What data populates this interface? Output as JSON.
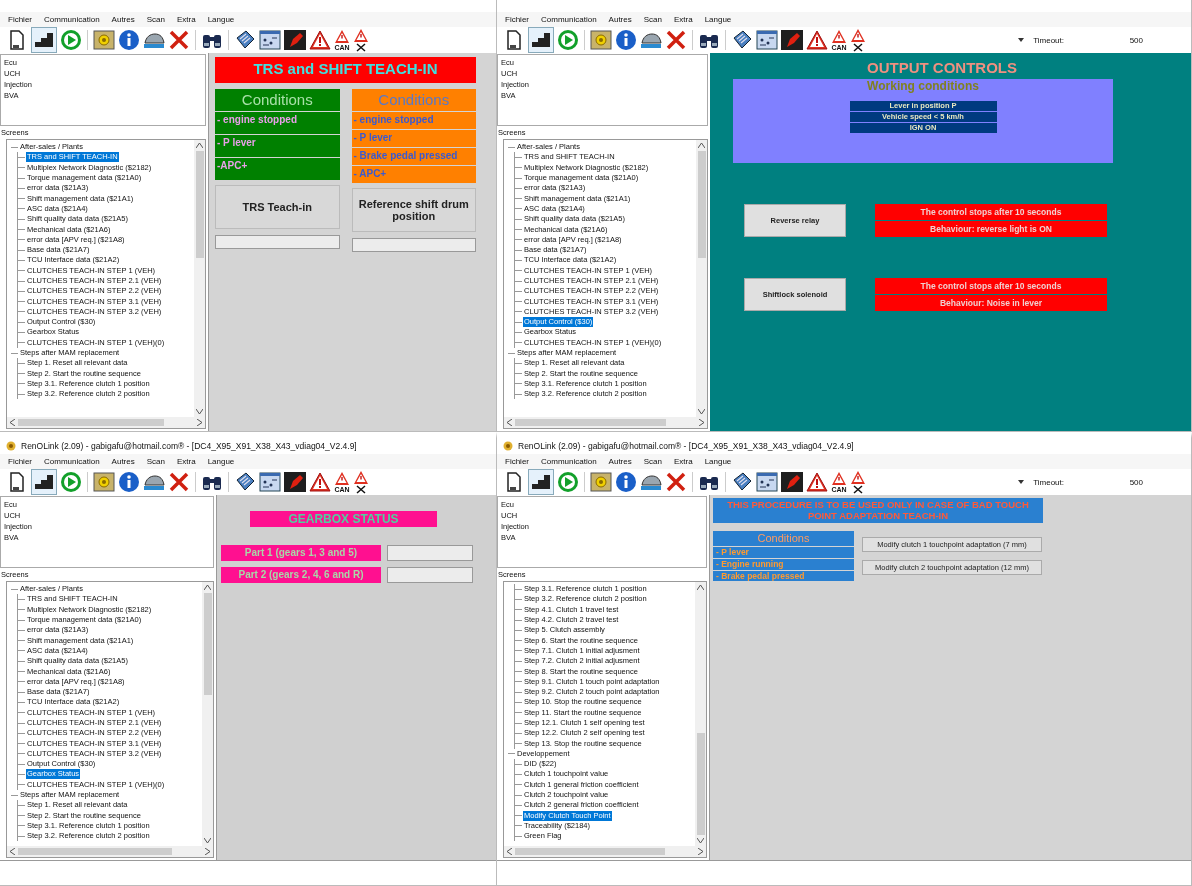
{
  "panes": [
    {
      "menu": [
        "Fichier",
        "Communication",
        "Autres",
        "Scan",
        "Extra",
        "Langue"
      ],
      "toolbar": {
        "can_label": "CAN"
      },
      "ecu_list": [
        "Ecu",
        "UCH",
        "Injection",
        "BVA"
      ],
      "screens_label": "Screens",
      "tree": [
        {
          "label": "After-sales / Plants",
          "children": [
            {
              "label": "TRS and SHIFT TEACH-IN",
              "selected": true
            },
            {
              "label": "Multiplex Network Diagnostic ($2182)",
              "selected": false
            },
            {
              "label": "Torque management data ($21A0)",
              "selected": false
            },
            {
              "label": "error data ($21A3)",
              "selected": false
            },
            {
              "label": "Shift management data ($21A1)",
              "selected": false
            },
            {
              "label": "ASC data ($21A4)",
              "selected": false
            },
            {
              "label": "Shift quality data data ($21A5)",
              "selected": false
            },
            {
              "label": "Mechanical data ($21A6)",
              "selected": false
            },
            {
              "label": "error data [APV req.] ($21A8)",
              "selected": false
            },
            {
              "label": "Base data ($21A7)",
              "selected": false
            },
            {
              "label": "TCU Interface data ($21A2)",
              "selected": false
            },
            {
              "label": "CLUTCHES TEACH-IN STEP 1 (VEH)",
              "selected": false
            },
            {
              "label": "CLUTCHES TEACH-IN STEP 2.1 (VEH)",
              "selected": false
            },
            {
              "label": "CLUTCHES TEACH-IN STEP 2.2 (VEH)",
              "selected": false
            },
            {
              "label": "CLUTCHES TEACH-IN STEP 3.1 (VEH)",
              "selected": false
            },
            {
              "label": "CLUTCHES TEACH-IN STEP 3.2 (VEH)",
              "selected": false
            },
            {
              "label": "Output Control ($30)",
              "selected": false
            },
            {
              "label": "Gearbox Status",
              "selected": false
            },
            {
              "label": "CLUTCHES TEACH-IN STEP 1 (VEH)(0)",
              "selected": false
            }
          ]
        },
        {
          "label": "Steps after MAM replacement",
          "children": [
            {
              "label": "Step 1. Reset all relevant data",
              "selected": false
            },
            {
              "label": "Step 2. Start the routine sequence",
              "selected": false
            },
            {
              "label": "Step 3.1. Reference clutch 1 position",
              "selected": false
            },
            {
              "label": "Step 3.2. Reference clutch 2 position",
              "selected": false
            }
          ]
        }
      ],
      "content": {
        "kind": "teach_in",
        "title": "TRS and  SHIFT TEACH-IN",
        "columns": [
          {
            "heading": "Conditions",
            "color": "#008000",
            "items": [
              "- engine stopped",
              "- P lever",
              "-APC+"
            ],
            "button": "TRS Teach-in"
          },
          {
            "heading": "Conditions",
            "color": "#ff8000",
            "items": [
              "- engine stopped",
              "- P lever",
              "- Brake pedal pressed",
              "- APC+"
            ],
            "button": "Reference shift drum position"
          }
        ]
      }
    },
    {
      "menu": [
        "Fichier",
        "Communication",
        "Autres",
        "Scan",
        "Extra",
        "Langue"
      ],
      "toolbar": {
        "can_label": "CAN"
      },
      "timeout": {
        "label": "Timeout:",
        "value": "500"
      },
      "ecu_list": [
        "Ecu",
        "UCH",
        "Injection",
        "BVA"
      ],
      "screens_label": "Screens",
      "tree": [
        {
          "label": "After-sales / Plants",
          "children": [
            {
              "label": "TRS and SHIFT TEACH-IN",
              "selected": false
            },
            {
              "label": "Multiplex Network Diagnostic ($2182)",
              "selected": false
            },
            {
              "label": "Torque management data ($21A0)",
              "selected": false
            },
            {
              "label": "error data ($21A3)",
              "selected": false
            },
            {
              "label": "Shift management data ($21A1)",
              "selected": false
            },
            {
              "label": "ASC data ($21A4)",
              "selected": false
            },
            {
              "label": "Shift quality data data ($21A5)",
              "selected": false
            },
            {
              "label": "Mechanical data ($21A6)",
              "selected": false
            },
            {
              "label": "error data [APV req.] ($21A8)",
              "selected": false
            },
            {
              "label": "Base data ($21A7)",
              "selected": false
            },
            {
              "label": "TCU Interface data ($21A2)",
              "selected": false
            },
            {
              "label": "CLUTCHES TEACH-IN STEP 1 (VEH)",
              "selected": false
            },
            {
              "label": "CLUTCHES TEACH-IN STEP 2.1 (VEH)",
              "selected": false
            },
            {
              "label": "CLUTCHES TEACH-IN STEP 2.2 (VEH)",
              "selected": false
            },
            {
              "label": "CLUTCHES TEACH-IN STEP 3.1 (VEH)",
              "selected": false
            },
            {
              "label": "CLUTCHES TEACH-IN STEP 3.2 (VEH)",
              "selected": false
            },
            {
              "label": "Output Control ($30)",
              "selected": true
            },
            {
              "label": "Gearbox Status",
              "selected": false
            },
            {
              "label": "CLUTCHES TEACH-IN STEP 1 (VEH)(0)",
              "selected": false
            }
          ]
        },
        {
          "label": "Steps after MAM replacement",
          "children": [
            {
              "label": "Step 1. Reset all relevant data",
              "selected": false
            },
            {
              "label": "Step 2. Start the routine sequence",
              "selected": false
            },
            {
              "label": "Step 3.1. Reference clutch 1 position",
              "selected": false
            },
            {
              "label": "Step 3.2. Reference clutch 2 position",
              "selected": false
            }
          ]
        }
      ],
      "content": {
        "kind": "output_controls",
        "title": "OUTPUT CONTROLS",
        "conditions": {
          "heading": "Working conditions",
          "items": [
            "Lever in position P",
            "Vehicle speed < 5 km/h",
            "IGN ON"
          ]
        },
        "controls": [
          {
            "button": "Reverse relay",
            "notes": [
              "The control stops after 10 seconds",
              "Behaviour: reverse light is ON"
            ]
          },
          {
            "button": "Shiftlock solenoid",
            "notes": [
              "The control stops after 10 seconds",
              "Behaviour: Noise in lever"
            ]
          }
        ]
      }
    },
    {
      "title": "RenOLink (2.09) - gabigafu@hotmail.com® -  [DC4_X95_X91_X38_X43_vdiag04_V2.4.9]",
      "menu": [
        "Fichier",
        "Communication",
        "Autres",
        "Scan",
        "Extra",
        "Langue"
      ],
      "toolbar": {
        "can_label": "CAN"
      },
      "ecu_list": [
        "Ecu",
        "UCH",
        "Injection",
        "BVA"
      ],
      "screens_label": "Screens",
      "tree": [
        {
          "label": "After-sales / Plants",
          "children": [
            {
              "label": "TRS and SHIFT TEACH-IN",
              "selected": false
            },
            {
              "label": "Multiplex Network Diagnostic ($2182)",
              "selected": false
            },
            {
              "label": "Torque management data ($21A0)",
              "selected": false
            },
            {
              "label": "error data ($21A3)",
              "selected": false
            },
            {
              "label": "Shift management data ($21A1)",
              "selected": false
            },
            {
              "label": "ASC data ($21A4)",
              "selected": false
            },
            {
              "label": "Shift quality data data ($21A5)",
              "selected": false
            },
            {
              "label": "Mechanical data ($21A6)",
              "selected": false
            },
            {
              "label": "error data [APV req.] ($21A8)",
              "selected": false
            },
            {
              "label": "Base data ($21A7)",
              "selected": false
            },
            {
              "label": "TCU Interface data ($21A2)",
              "selected": false
            },
            {
              "label": "CLUTCHES TEACH-IN STEP 1 (VEH)",
              "selected": false
            },
            {
              "label": "CLUTCHES TEACH-IN STEP 2.1 (VEH)",
              "selected": false
            },
            {
              "label": "CLUTCHES TEACH-IN STEP 2.2 (VEH)",
              "selected": false
            },
            {
              "label": "CLUTCHES TEACH-IN STEP 3.1 (VEH)",
              "selected": false
            },
            {
              "label": "CLUTCHES TEACH-IN STEP 3.2 (VEH)",
              "selected": false
            },
            {
              "label": "Output Control ($30)",
              "selected": false
            },
            {
              "label": "Gearbox Status",
              "selected": true
            },
            {
              "label": "CLUTCHES TEACH-IN STEP 1 (VEH)(0)",
              "selected": false
            }
          ]
        },
        {
          "label": "Steps after MAM replacement",
          "children": [
            {
              "label": "Step 1. Reset all relevant data",
              "selected": false
            },
            {
              "label": "Step 2. Start the routine sequence",
              "selected": false
            },
            {
              "label": "Step 3.1. Reference clutch 1 position",
              "selected": false
            },
            {
              "label": "Step 3.2. Reference clutch 2 position",
              "selected": false
            }
          ]
        }
      ],
      "content": {
        "kind": "gearbox_status",
        "title": "GEARBOX STATUS",
        "parts": [
          "Part 1 (gears 1, 3 and 5)",
          "Part 2 (gears 2, 4, 6 and R)"
        ]
      }
    },
    {
      "title": "RenOLink (2.09) - gabigafu@hotmail.com® -  [DC4_X95_X91_X38_X43_vdiag04_V2.4.9]",
      "menu": [
        "Fichier",
        "Communication",
        "Autres",
        "Scan",
        "Extra",
        "Langue"
      ],
      "toolbar": {
        "can_label": "CAN"
      },
      "timeout": {
        "label": "Timeout:",
        "value": "500"
      },
      "ecu_list": [
        "Ecu",
        "UCH",
        "Injection",
        "BVA"
      ],
      "screens_label": "Screens",
      "tree": [
        {
          "children": [
            {
              "label": "Step 3.1. Reference clutch 1 position",
              "selected": false
            },
            {
              "label": "Step 3.2. Reference clutch 2 position",
              "selected": false
            },
            {
              "label": "Step 4.1. Clutch 1 travel test",
              "selected": false
            },
            {
              "label": "Step 4.2. Clutch 2 travel test",
              "selected": false
            },
            {
              "label": "Step 5. Clutch assembly",
              "selected": false
            },
            {
              "label": "Step 6. Start the routine sequence",
              "selected": false
            },
            {
              "label": "Step 7.1. Clutch 1 initial adjusment",
              "selected": false
            },
            {
              "label": "Step 7.2. Clutch 2 initial adjusment",
              "selected": false
            },
            {
              "label": "Step 8. Start the routine sequence",
              "selected": false
            },
            {
              "label": "Step 9.1. Clutch 1 touch point adaptation",
              "selected": false
            },
            {
              "label": "Step 9.2. Clutch 2 touch point adaptation",
              "selected": false
            },
            {
              "label": "Step 10. Stop the routine sequence",
              "selected": false
            },
            {
              "label": "Step 11. Start the routine sequence",
              "selected": false
            },
            {
              "label": "Step 12.1. Clutch 1 self opening test",
              "selected": false
            },
            {
              "label": "Step 12.2. Clutch 2 self opening test",
              "selected": false
            },
            {
              "label": "Step 13. Stop the routine sequence",
              "selected": false
            }
          ]
        },
        {
          "label": "Developpement",
          "children": [
            {
              "label": "DID ($22)",
              "selected": false
            },
            {
              "label": "Clutch 1 touchpoint value",
              "selected": false
            },
            {
              "label": "Clutch 1 general friction coefficient",
              "selected": false
            },
            {
              "label": "Clutch 2 touchpoint value",
              "selected": false
            },
            {
              "label": "Clutch 2 general friction coefficient",
              "selected": false
            },
            {
              "label": "Modify Clutch Touch Point",
              "selected": true
            },
            {
              "label": "Traceability ($2184)",
              "selected": false
            },
            {
              "label": "Green Flag",
              "selected": false
            }
          ]
        }
      ],
      "content": {
        "kind": "touch_point",
        "banner": "THIS PROCEDURE IS TO BE USED ONLY IN CASE OF BAD TOUCH POINT ADAPTATION TEACH-IN",
        "conditions": {
          "heading": "Conditions",
          "items": [
            "- P lever",
            "- Engine running",
            "- Brake pedal pressed"
          ]
        },
        "buttons": [
          "Modify clutch 1 touchpoint adaptation (7 mm)",
          "Modify clutch 2 touchpoint adaptation (12 mm)"
        ]
      }
    }
  ]
}
